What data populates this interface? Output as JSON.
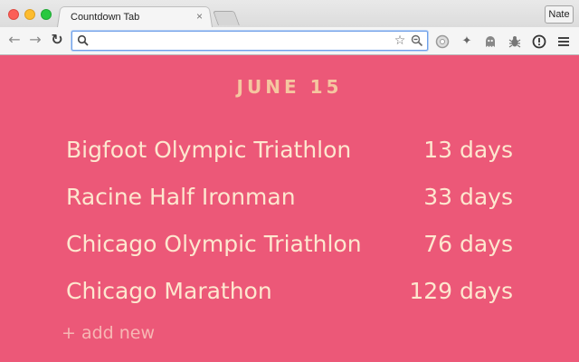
{
  "browser": {
    "tab_title": "Countdown Tab",
    "tab_close": "×",
    "profile_name": "Nate",
    "address_value": ""
  },
  "page": {
    "date": "JUNE 15",
    "events": [
      {
        "name": "Bigfoot Olympic Triathlon",
        "days": "13 days"
      },
      {
        "name": "Racine Half Ironman",
        "days": "33 days"
      },
      {
        "name": "Chicago Olympic Triathlon",
        "days": "76 days"
      },
      {
        "name": "Chicago Marathon",
        "days": "129 days"
      }
    ],
    "add_label": "+ add new"
  },
  "colors": {
    "background": "#ec5878",
    "date_text": "#f5c6a0",
    "event_text": "#fde7cf",
    "add_text": "#f7b7b4"
  },
  "icons": {
    "back": "back-arrow-icon",
    "forward": "forward-arrow-icon",
    "reload": "reload-icon",
    "search": "search-icon",
    "bookmark": "star-icon",
    "zoom": "zoom-icon",
    "extensions": [
      "circle-extension-icon",
      "pin-extension-icon",
      "ghost-extension-icon",
      "bug-extension-icon",
      "alert-extension-icon"
    ],
    "menu": "hamburger-menu-icon"
  }
}
